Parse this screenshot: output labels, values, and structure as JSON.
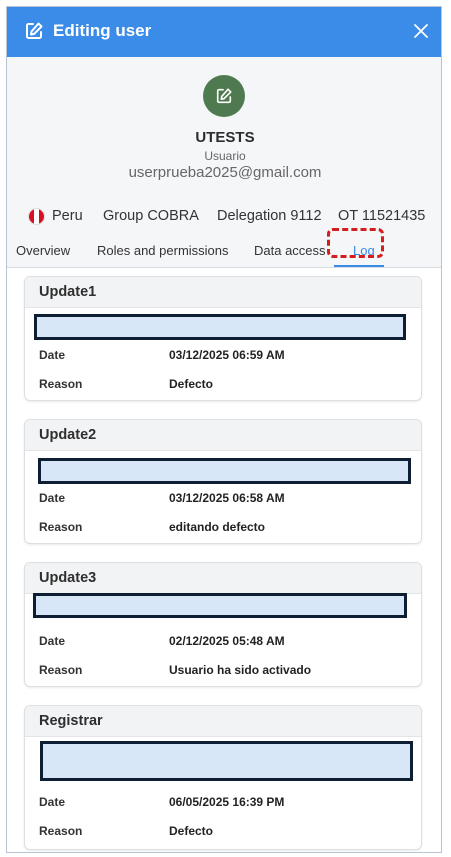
{
  "header": {
    "title": "Editing user",
    "edit_icon": "edit-square-icon",
    "close_icon": "close-icon"
  },
  "profile": {
    "avatar_icon": "edit-square-icon",
    "name": "UTESTS",
    "role": "Usuario",
    "email": "userprueba2025@gmail.com",
    "country": "Peru",
    "country_flag": "peru-flag-icon",
    "group": "Group COBRA",
    "delegation": "Delegation 9112",
    "ot": "OT 11521435"
  },
  "tabs": [
    {
      "label": "Overview",
      "active": false
    },
    {
      "label": "Roles and permissions",
      "active": false
    },
    {
      "label": "Data access",
      "active": false
    },
    {
      "label": "Log",
      "active": true
    }
  ],
  "log": {
    "date_label": "Date",
    "reason_label": "Reason",
    "entries": [
      {
        "title": "Update1",
        "date": "03/12/2025 06:59 AM",
        "reason": "Defecto"
      },
      {
        "title": "Update2",
        "date": "03/12/2025 06:58 AM",
        "reason": "editando defecto"
      },
      {
        "title": "Update3",
        "date": "02/12/2025 05:48 AM",
        "reason": "Usuario ha sido activado"
      },
      {
        "title": "Registrar",
        "date": "06/05/2025 16:39 PM",
        "reason": "Defecto"
      }
    ]
  },
  "colors": {
    "accent": "#3b8be8",
    "avatar_bg": "#4f7a4f",
    "highlight": "#d41e1e",
    "redaction_fill": "#d8e7f7"
  }
}
